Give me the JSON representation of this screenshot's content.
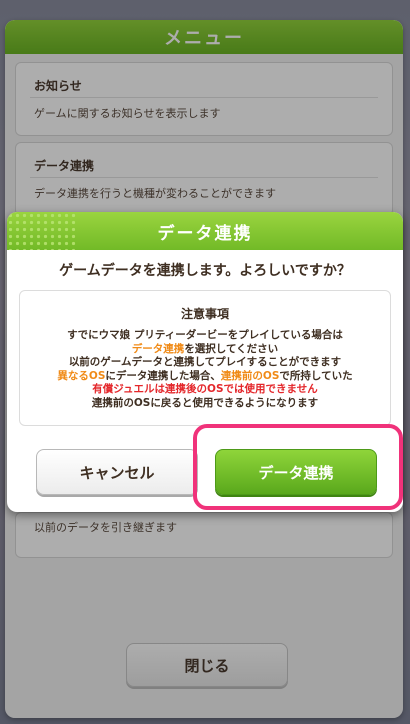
{
  "menu": {
    "title": "メニュー",
    "cards": [
      {
        "title": "お知らせ",
        "description": "ゲームに関するお知らせを表示します"
      },
      {
        "title": "データ連携",
        "description": "データ連携を行うと機種が変わることができます"
      }
    ],
    "lower_card_text": "以前のデータを引き継ぎます",
    "close_label": "閉じる"
  },
  "dialog": {
    "title": "データ連携",
    "question": "ゲームデータを連携します。よろしいですか？",
    "notice_title": "注意事項",
    "notice": {
      "line1": "すでにウマ娘 プリティーダービーをプレイしている場合は",
      "line2_em": "データ連携",
      "line2_rest": "を選択してください",
      "line3": "以前のゲームデータと連携してプレイすることができます",
      "line4_a": "異なるOS",
      "line4_b": "にデータ連携した場合、",
      "line4_c": "連携前のOS",
      "line4_d": "で所持していた",
      "line5": "有償ジュエルは連携後のOSでは使用できません",
      "line6": "連携前のOSに戻ると使用できるようになります"
    },
    "cancel_label": "キャンセル",
    "confirm_label": "データ連携"
  },
  "colors": {
    "accent_green": "#72ba27",
    "highlight_pink": "#f0327a",
    "notice_orange": "#f08a16",
    "notice_red": "#e4272b"
  }
}
